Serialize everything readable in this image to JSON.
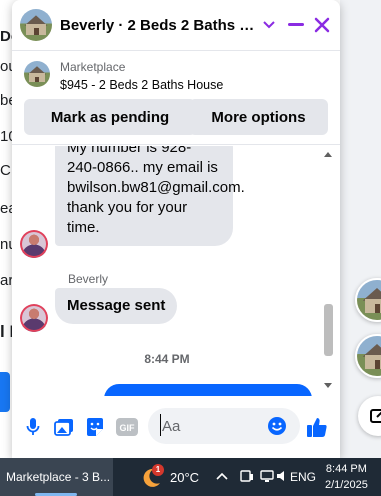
{
  "background_page": {
    "fragments": [
      "De",
      "ou",
      "be",
      "10",
      "C a",
      "ea",
      "nu",
      "ark",
      "l I"
    ]
  },
  "chat": {
    "header": {
      "title": "Beverly · 2 Beds 2 Baths H..."
    },
    "listing": {
      "source": "Marketplace",
      "title": "$945 - 2 Beds 2 Baths House",
      "mark_pending_label": "Mark as pending",
      "more_options_label": "More options"
    },
    "messages": {
      "first_bubble": "My number is 928-240-0866.. my email is bwilson.bw81@gmail.com. thank you for your time.",
      "sender_name": "Beverly",
      "second_bubble": "Message sent",
      "timestamp": "8:44 PM"
    },
    "composer": {
      "placeholder": "Aa",
      "gif_label": "GIF"
    }
  },
  "taskbar": {
    "active_app": "Marketplace - 3 B...",
    "weather_badge": "1",
    "temperature": "20°C",
    "language": "ENG",
    "time": "8:44 PM",
    "date": "2/1/2025"
  },
  "colors": {
    "accent": "#8a2be2",
    "messenger_blue": "#0866ff",
    "bubble_gray": "#e4e6eb",
    "taskbar": "#1f2a36"
  }
}
